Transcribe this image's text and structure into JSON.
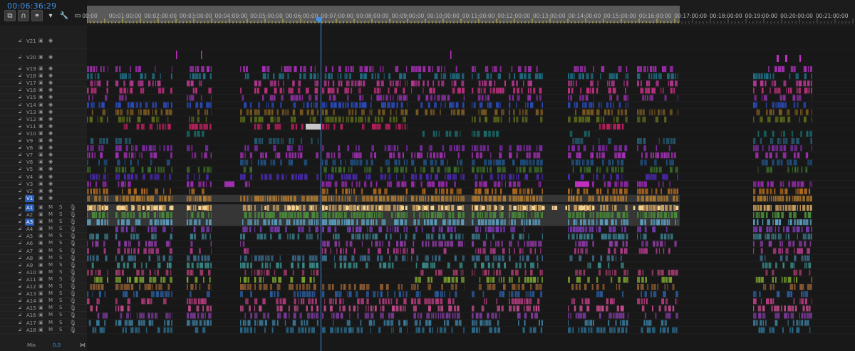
{
  "timecode": "00:06:36:29",
  "toolbar": {
    "items": [
      "nest-icon",
      "snap-icon",
      "linked-selection-icon",
      "marker-icon",
      "wrench-icon",
      "captions-icon"
    ]
  },
  "ruler": {
    "labels": [
      "00:00",
      "00:01:00:00",
      "00:02:00:00",
      "00:03:00:00",
      "00:04:00:00",
      "00:05:00:00",
      "00:06:00:00",
      "00:07:00:00",
      "00:08:00:00",
      "00:09:00:00",
      "00:10:00:00",
      "00:11:00:00",
      "00:12:00:00",
      "00:13:00:00",
      "00:14:00:00",
      "00:15:00:00",
      "00:16:00:00",
      "00:17:00:00",
      "00:18:00:00",
      "00:19:00:00",
      "00:20:00:00",
      "00:21:00:00"
    ]
  },
  "video_tracks": [
    {
      "name": "V21"
    },
    {
      "name": "V20"
    },
    {
      "name": "V19"
    },
    {
      "name": "V18"
    },
    {
      "name": "V17"
    },
    {
      "name": "V16"
    },
    {
      "name": "V15"
    },
    {
      "name": "V14"
    },
    {
      "name": "V13"
    },
    {
      "name": "V12"
    },
    {
      "name": "V11"
    },
    {
      "name": "V10"
    },
    {
      "name": "V9"
    },
    {
      "name": "V8"
    },
    {
      "name": "V7"
    },
    {
      "name": "V6"
    },
    {
      "name": "V5"
    },
    {
      "name": "V4"
    },
    {
      "name": "V3"
    },
    {
      "name": "V2"
    },
    {
      "name": "V1",
      "selected": true
    }
  ],
  "audio_tracks": [
    {
      "name": "A1",
      "selected": true
    },
    {
      "name": "A2"
    },
    {
      "name": "A3",
      "selected": true
    },
    {
      "name": "A4"
    },
    {
      "name": "A5"
    },
    {
      "name": "A6"
    },
    {
      "name": "A7"
    },
    {
      "name": "A8"
    },
    {
      "name": "A9"
    },
    {
      "name": "A10"
    },
    {
      "name": "A11"
    },
    {
      "name": "A12"
    },
    {
      "name": "A13"
    },
    {
      "name": "A14"
    },
    {
      "name": "A15"
    },
    {
      "name": "A16"
    },
    {
      "name": "A17"
    },
    {
      "name": "A18"
    }
  ],
  "track_buttons": {
    "mute": "M",
    "solo": "S"
  },
  "mix": {
    "label": "Mix",
    "value": "0.0"
  }
}
